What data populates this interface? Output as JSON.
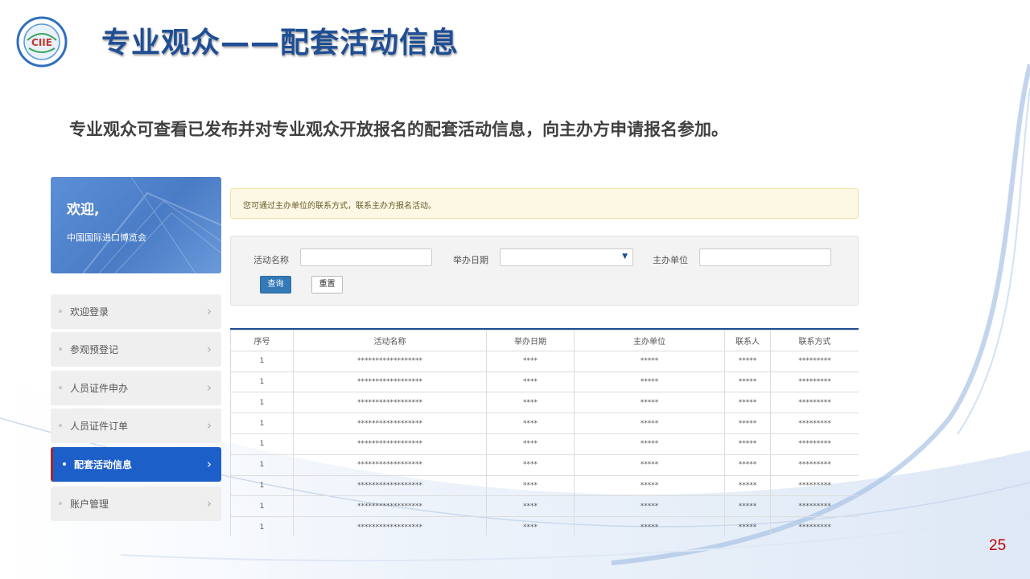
{
  "header": {
    "logo_text": "CIIE",
    "title": "专业观众——配套活动信息",
    "subtitle": "专业观众可查看已发布并对专业观众开放报名的配套活动信息，向主办方申请报名参加。"
  },
  "sidebar": {
    "welcome_title": "欢迎,",
    "welcome_org": "中国国际进口博览会",
    "items": [
      {
        "label": "欢迎登录",
        "active": false
      },
      {
        "label": "参观预登记",
        "active": false
      },
      {
        "label": "人员证件申办",
        "active": false
      },
      {
        "label": "人员证件订单",
        "active": false
      },
      {
        "label": "配套活动信息",
        "active": true
      },
      {
        "label": "账户管理",
        "active": false
      }
    ],
    "chevron": "›"
  },
  "notice": {
    "text": "您可通过主办单位的联系方式，联系主办方报名活动。"
  },
  "search": {
    "activity_name_label": "活动名称",
    "activity_name_value": "",
    "date_label": "举办日期",
    "date_value": "",
    "organizer_label": "主办单位",
    "organizer_value": "",
    "query_button": "查询",
    "reset_button": "重置"
  },
  "table": {
    "columns": [
      "序号",
      "活动名称",
      "举办日期",
      "主办单位",
      "联系人",
      "联系方式"
    ],
    "rows": [
      [
        "1",
        "******************",
        "****",
        "*****",
        "*****",
        "*********"
      ],
      [
        "1",
        "******************",
        "****",
        "*****",
        "*****",
        "*********"
      ],
      [
        "1",
        "******************",
        "****",
        "*****",
        "*****",
        "*********"
      ],
      [
        "1",
        "******************",
        "****",
        "*****",
        "*****",
        "*********"
      ],
      [
        "1",
        "******************",
        "****",
        "*****",
        "*****",
        "*********"
      ],
      [
        "1",
        "******************",
        "****",
        "*****",
        "*****",
        "*********"
      ],
      [
        "1",
        "******************",
        "****",
        "*****",
        "*****",
        "*********"
      ],
      [
        "1",
        "******************",
        "****",
        "*****",
        "*****",
        "*********"
      ],
      [
        "1",
        "******************",
        "****",
        "*****",
        "*****",
        "*********"
      ]
    ]
  },
  "page_number": "25",
  "colors": {
    "title": "#1f4e94",
    "active_nav": "#1d5fc9",
    "query_button": "#337ab7",
    "page_number": "#c00000"
  }
}
